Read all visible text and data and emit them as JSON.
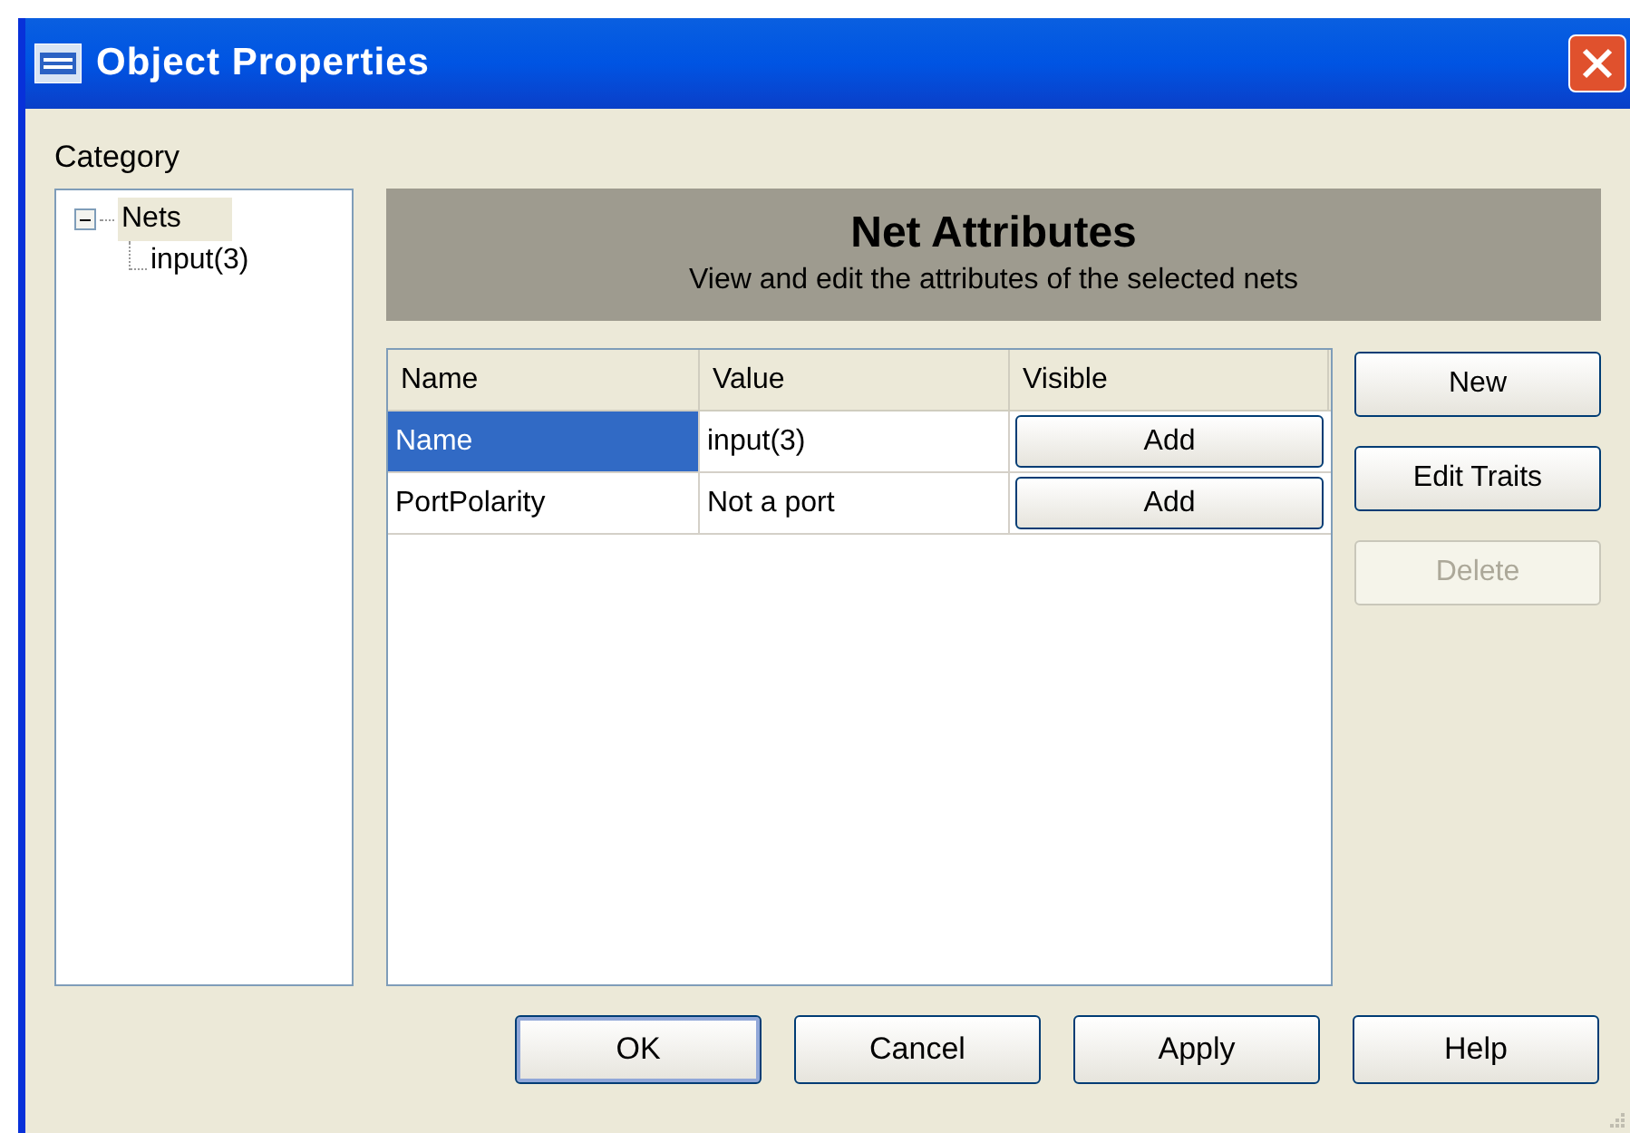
{
  "window": {
    "title": "Object Properties"
  },
  "category": {
    "label": "Category",
    "tree": [
      {
        "label": "Nets",
        "expanded": true,
        "selected": true,
        "children": [
          {
            "label": "input(3)",
            "selected": false
          }
        ]
      }
    ]
  },
  "header": {
    "title": "Net Attributes",
    "subtitle": "View and edit the attributes of the selected nets"
  },
  "table": {
    "columns": [
      "Name",
      "Value",
      "Visible"
    ],
    "rows": [
      {
        "name": "Name",
        "value": "input(3)",
        "visible": "Add",
        "selected": true
      },
      {
        "name": "PortPolarity",
        "value": "Not a port",
        "visible": "Add",
        "selected": false
      }
    ]
  },
  "side_buttons": [
    {
      "label": "New",
      "disabled": false
    },
    {
      "label": "Edit Traits",
      "disabled": false
    },
    {
      "label": "Delete",
      "disabled": true
    }
  ],
  "buttons": [
    {
      "label": "OK",
      "default": true
    },
    {
      "label": "Cancel",
      "default": false
    },
    {
      "label": "Apply",
      "default": false
    },
    {
      "label": "Help",
      "default": false
    }
  ]
}
